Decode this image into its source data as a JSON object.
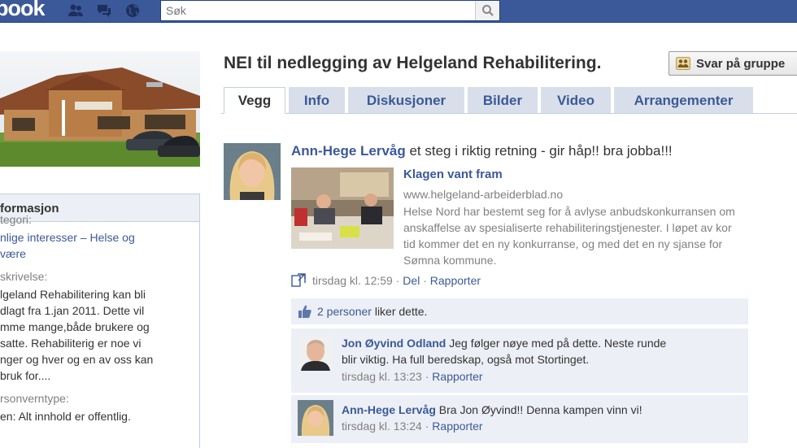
{
  "topbar": {
    "logo_text": "book",
    "search_placeholder": "Søk",
    "icons": [
      "friend-requests-icon",
      "messages-icon",
      "notifications-globe-icon",
      "search-icon"
    ]
  },
  "colors": {
    "brand": "#3b5998",
    "tab_bg": "#d8dfea",
    "feedback_bg": "#eceff5",
    "meta_gray": "#808080"
  },
  "sidebar": {
    "info_heading": "formasjon",
    "category_label": "tegori:",
    "category_value_line1": "nlige interesser – Helse og",
    "category_value_line2": "være",
    "description_label": "skrivelse:",
    "description_lines": [
      "lgeland Rehabilitering kan bli",
      "dlagt fra 1.jan 2011. Dette vil",
      "mme mange,både brukere og",
      "satte. Rehabiliterig er noe vi",
      "nger og hver og en av oss kan",
      "bruk for...."
    ],
    "privacy_label": "rsonverntype:",
    "privacy_value": "en: Alt innhold er offentlig."
  },
  "page": {
    "title": "NEI til nedlegging av Helgeland Rehabilitering.",
    "join_button": "Svar på gruppe"
  },
  "tabs": [
    {
      "label": "Vegg",
      "active": true
    },
    {
      "label": "Info",
      "active": false
    },
    {
      "label": "Diskusjoner",
      "active": false
    },
    {
      "label": "Bilder",
      "active": false
    },
    {
      "label": "Video",
      "active": false
    },
    {
      "label": "Arrangementer",
      "active": false
    }
  ],
  "post": {
    "author": "Ann-Hege Lervåg",
    "message": " et steg i riktig retning - gir håp!! bra jobba!!!",
    "attachment": {
      "title": "Klagen vant fram",
      "url": "www.helgeland-arbeiderblad.no",
      "description_lines": [
        "Helse Nord har bestemt seg for å avlyse anbudskonkurransen om",
        "anskaffelse av spesialiserte rehabiliteringstjenester. I løpet av kor",
        "tid kommer det en ny konkurranse, og med det en ny sjanse for",
        "Sømna kommune."
      ]
    },
    "time": "tirsdag kl. 12:59",
    "sep1": " · ",
    "share_link": "Del",
    "sep2": " · ",
    "report_link": "Rapporter",
    "likes_link": "2 personer",
    "likes_rest": " liker dette."
  },
  "comments": [
    {
      "author": "Jon Øyvind Odland",
      "text_line1": " Jeg følger nøye med på dette. Neste runde",
      "text_line2": "blir viktig. Ha full beredskap, også mot Stortinget.",
      "time": "tirsdag kl. 13:23",
      "sep": " · ",
      "report": "Rapporter"
    },
    {
      "author": "Ann-Hege Lervåg",
      "text_line1": " Bra Jon Øyvind!! Denna kampen vinn vi!",
      "time": "tirsdag kl. 13:24",
      "sep": " · ",
      "report": "Rapporter"
    }
  ]
}
